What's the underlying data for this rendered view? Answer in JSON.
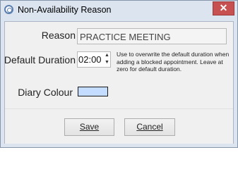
{
  "window": {
    "title": "Non-Availability Reason",
    "close_label": "✕",
    "frame_color": "#dbe4ef",
    "close_color": "#c75050"
  },
  "form": {
    "reason_label": "Reason",
    "reason_value": "PRACTICE MEETING",
    "duration_label": "Default Duration",
    "duration_value": "02:00",
    "spin_up": "▲",
    "spin_down": "▼",
    "duration_hint": "Use to overwrite the default duration when adding a blocked appointment. Leave at zero for default duration.",
    "colour_label": "Diary Colour",
    "colour_value": "#c4dcff"
  },
  "buttons": {
    "save_label": "Save",
    "cancel_label": "Cancel"
  }
}
